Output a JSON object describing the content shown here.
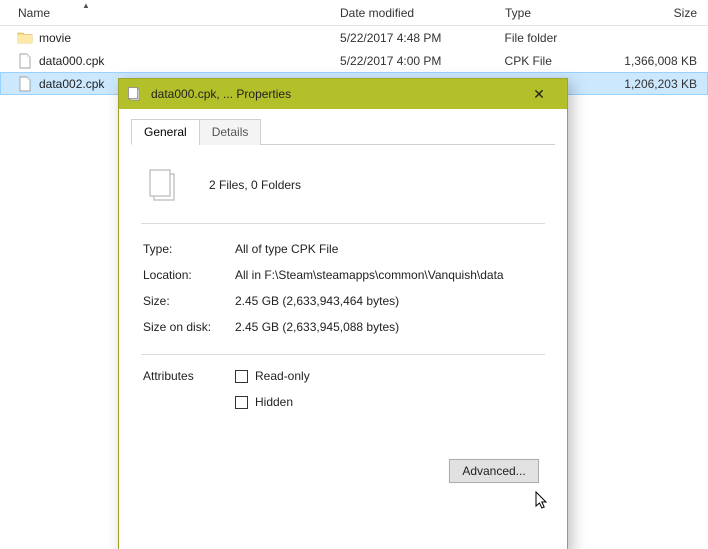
{
  "explorer": {
    "columns": {
      "name": "Name",
      "date": "Date modified",
      "type": "Type",
      "size": "Size"
    },
    "rows": [
      {
        "name": "movie",
        "date": "5/22/2017 4:48 PM",
        "type": "File folder",
        "size": "",
        "icon": "folder",
        "selected": false
      },
      {
        "name": "data000.cpk",
        "date": "5/22/2017 4:00 PM",
        "type": "CPK File",
        "size": "1,366,008 KB",
        "icon": "file",
        "selected": false
      },
      {
        "name": "data002.cpk",
        "date": "",
        "type": "",
        "size": "1,206,203 KB",
        "icon": "file",
        "selected": true
      }
    ]
  },
  "dialog": {
    "title": "data000.cpk, ... Properties",
    "tabs": {
      "general": "General",
      "details": "Details"
    },
    "summary": "2 Files, 0 Folders",
    "fields": {
      "type_label": "Type:",
      "type_value": "All of type CPK File",
      "location_label": "Location:",
      "location_value": "All in F:\\Steam\\steamapps\\common\\Vanquish\\data",
      "size_label": "Size:",
      "size_value": "2.45 GB (2,633,943,464 bytes)",
      "diskSize_label": "Size on disk:",
      "diskSize_value": "2.45 GB (2,633,945,088 bytes)"
    },
    "attributes": {
      "label": "Attributes",
      "readonly": "Read-only",
      "hidden": "Hidden",
      "advanced": "Advanced..."
    }
  }
}
